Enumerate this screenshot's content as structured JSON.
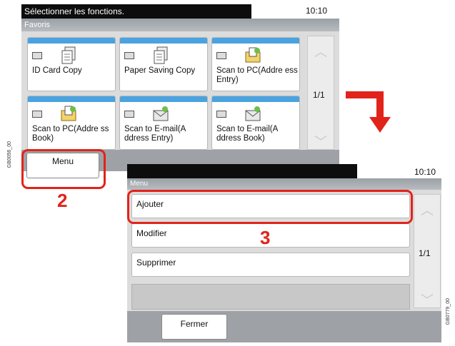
{
  "screen1": {
    "title": "Sélectionner les fonctions.",
    "time": "10:10",
    "section": "Favoris",
    "tiles": [
      {
        "label": "ID Card Copy",
        "icon": "copy-document-icon"
      },
      {
        "label": "Paper Saving Copy",
        "icon": "copy-document-icon"
      },
      {
        "label": "Scan to PC(Addre ess Entry)",
        "icon": "scan-folder-icon"
      },
      {
        "label": "Scan to PC(Addre ss Book)",
        "icon": "scan-folder-icon"
      },
      {
        "label": "Scan to E-mail(A ddress Entry)",
        "icon": "scan-email-icon"
      },
      {
        "label": "Scan to E-mail(A ddress Book)",
        "icon": "scan-email-icon"
      }
    ],
    "page": "1/1",
    "menu_button": "Menu",
    "side_code": "GB0056_00"
  },
  "step_numbers": {
    "menu": "2",
    "add": "3"
  },
  "screen2": {
    "time": "10:10",
    "section": "Menu",
    "items": [
      "Ajouter",
      "Modifier",
      "Supprimer"
    ],
    "page": "1/1",
    "close_button": "Fermer",
    "side_code": "GB0779_00"
  },
  "colors": {
    "callout": "#e2231a",
    "tile_stripe": "#4aa3df",
    "title_bar": "#0d0d0d"
  }
}
